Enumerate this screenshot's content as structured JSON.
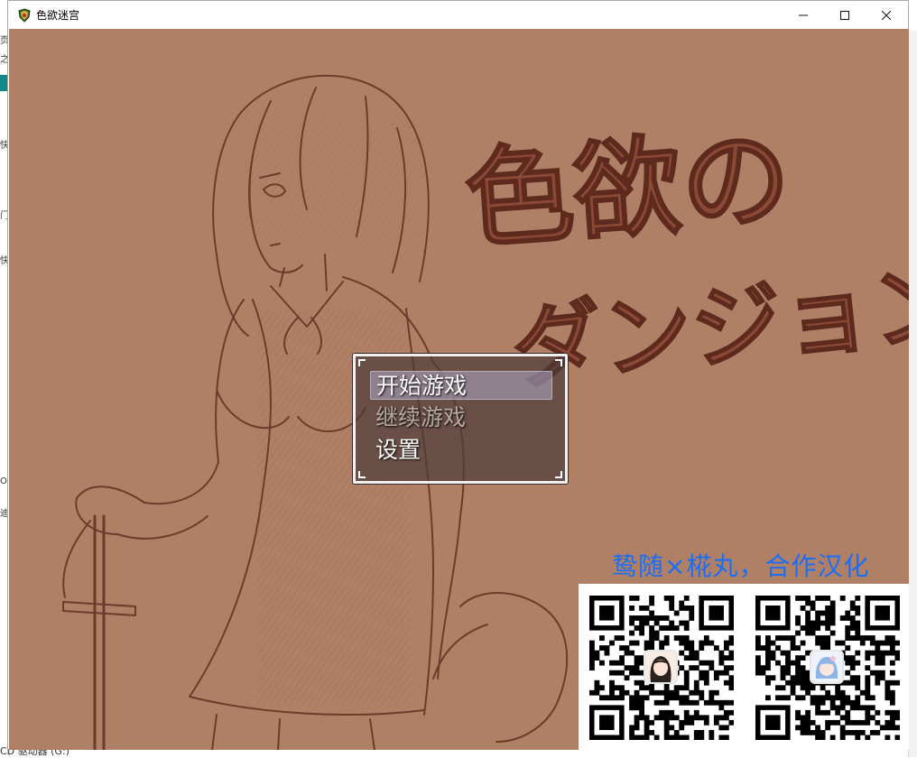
{
  "window": {
    "title": "色欲迷宫",
    "icon": "game-shield-icon",
    "buttons": {
      "minimize": "minimize-icon",
      "maximize": "maximize-icon",
      "close": "close-icon"
    }
  },
  "background": {
    "left_edge_glyphs": [
      "页",
      "之",
      "快",
      "门",
      "快",
      "O",
      "迪"
    ],
    "bottom_left_text": "CD 驱动器 (G:)"
  },
  "game": {
    "logo_line1": "色欲の",
    "logo_line2": "ダンジョン",
    "menu": {
      "items": [
        {
          "label": "开始游戏",
          "state": "selected"
        },
        {
          "label": "继续游戏",
          "state": "disabled"
        },
        {
          "label": "设置",
          "state": "normal"
        }
      ]
    },
    "credit": "鸷随×椛丸，合作汉化",
    "qr_codes": [
      "qr-code-1",
      "qr-code-2"
    ]
  },
  "colors": {
    "background": "#b08066",
    "line_art": "#6e3a2c",
    "logo": "#8c4a36",
    "credit_text": "#1a6ef5",
    "menu_fill": "#4e3c3a"
  }
}
